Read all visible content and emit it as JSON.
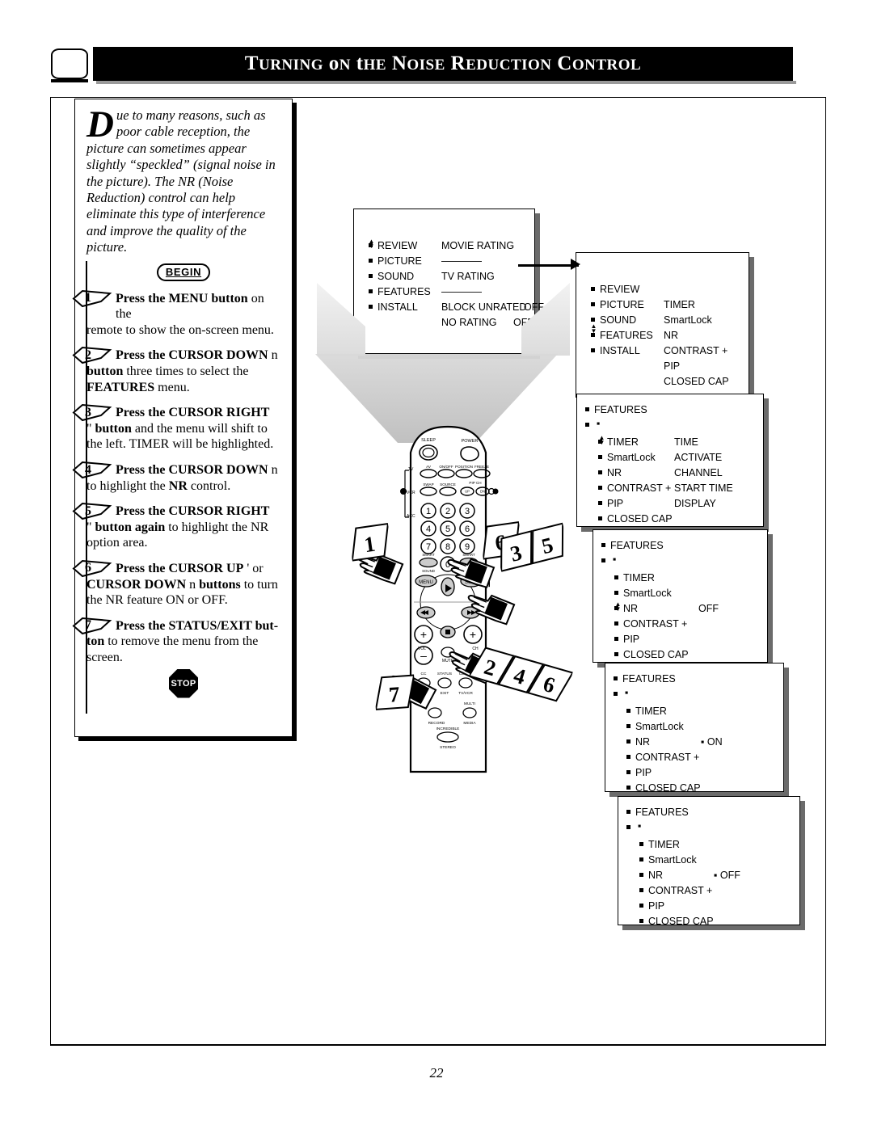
{
  "header": {
    "title": "Turning on the Noise Reduction Control",
    "tv_icon": "tv-screen-icon"
  },
  "intro": {
    "dropcap": "D",
    "text": "ue to many reasons, such as poor cable reception, the picture can sometimes appear slightly “speckled” (signal noise in the picture). The NR (Noise Reduction) control can help eliminate this type of interference and improve the quality of the picture."
  },
  "begin_label": "BEGIN",
  "stop_label": "STOP",
  "steps": [
    {
      "number": "1",
      "line1": "Press the MENU button",
      "line1_tail": " on the",
      "rest": "remote to show the on-screen menu."
    },
    {
      "number": "2",
      "line1": "Press the CURSOR DOWN",
      "line1_tail": " n",
      "rest": "button three times to select the FEATURES menu."
    },
    {
      "number": "3",
      "line1": "Press the CURSOR RIGHT",
      "line1_tail": "",
      "rest": "\" button and the menu will shift to the left. TIMER will be highlighted."
    },
    {
      "number": "4",
      "line1": "Press the CURSOR DOWN",
      "line1_tail": " n",
      "rest": "to highlight the NR control."
    },
    {
      "number": "5",
      "line1": "Press the CURSOR RIGHT",
      "line1_tail": "",
      "rest": "\" button again to highlight the NR option area."
    },
    {
      "number": "6",
      "line1": "Press the CURSOR UP",
      "line1_tail": " '   or",
      "rest": "CURSOR DOWN n buttons to turn the NR feature ON or OFF."
    },
    {
      "number": "7",
      "line1": "Press the STATUS/EXIT but-",
      "line1_tail": "",
      "rest": "ton to remove the menu from the screen."
    }
  ],
  "screens": [
    {
      "id": "screen-main-menu",
      "left_items": [
        "REVIEW",
        "PICTURE",
        "SOUND",
        "FEATURES",
        "INSTALL"
      ],
      "right_items": [
        "MOVIE RATING",
        "————",
        "TV RATING",
        "————",
        "BLOCK UNRATED",
        "NO RATING"
      ],
      "values": [
        "",
        "",
        "",
        "",
        "OFF",
        "OFF"
      ],
      "cursor_row": 0
    },
    {
      "id": "screen-features-selected",
      "left_items": [
        "REVIEW",
        "PICTURE",
        "SOUND",
        "FEATURES",
        "INSTALL"
      ],
      "right_items": [
        "",
        "TIMER",
        "SmartLock",
        "NR",
        "CONTRAST +",
        "PIP",
        "CLOSED CAP"
      ],
      "cursor_row": 3
    },
    {
      "id": "screen-features-timer",
      "title": "FEATURES",
      "left_items": [
        "TIMER",
        "SmartLock",
        "NR",
        "CONTRAST +",
        "PIP",
        "CLOSED CAP"
      ],
      "right_items": [
        "TIME",
        "ACTIVATE",
        "CHANNEL",
        "START TIME",
        "DISPLAY"
      ],
      "cursor_row": 0
    },
    {
      "id": "screen-features-nr-off",
      "title": "FEATURES",
      "left_items": [
        "TIMER",
        "SmartLock",
        "NR",
        "CONTRAST +",
        "PIP",
        "CLOSED CAP"
      ],
      "nr_value": "OFF",
      "cursor_row": 2
    },
    {
      "id": "screen-features-nr-on",
      "title": "FEATURES",
      "left_items": [
        "TIMER",
        "SmartLock",
        "NR",
        "CONTRAST +",
        "PIP",
        "CLOSED CAP"
      ],
      "nr_value": "ON",
      "cursor_row": 2
    },
    {
      "id": "screen-features-nr-off-final",
      "title": "FEATURES",
      "left_items": [
        "TIMER",
        "SmartLock",
        "NR",
        "CONTRAST +",
        "PIP",
        "CLOSED CAP"
      ],
      "nr_value": "OFF",
      "cursor_row": 2
    }
  ],
  "remote": {
    "labels": {
      "sleep": "SLEEP",
      "power": "POWER",
      "tv": "TV",
      "vcr": "VCR",
      "acc": "ACC",
      "av": "AV",
      "onoff": "ON/OFF",
      "position": "POSITION",
      "freeze": "FREEZE",
      "swap": "SWAP",
      "source": "SOURCE",
      "pipch": "PIP CH",
      "up": "UP",
      "dn": "DN",
      "smart_sound": "SMART SOUND",
      "smart_picture": "SMART PICTURE",
      "menu": "MENU",
      "surf": "SURF",
      "vol": "VOL",
      "ch": "CH",
      "mute": "MUTE",
      "cc": "CC",
      "status_exit": "STATUS EXIT",
      "clock": "CLOCK",
      "tvvcr": "TV/VCR",
      "record": "RECORD",
      "multi_media": "MULTI MEDIA",
      "incredible_stereo": "INCREDIBLE STEREO"
    },
    "keypad": [
      "1",
      "2",
      "3",
      "4",
      "5",
      "6",
      "7",
      "8",
      "9",
      "0"
    ]
  },
  "callouts": [
    {
      "id": "callout-1",
      "labels": [
        "1"
      ]
    },
    {
      "id": "callout-6",
      "labels": [
        "6"
      ]
    },
    {
      "id": "callout-3-5",
      "labels": [
        "3",
        "5"
      ]
    },
    {
      "id": "callout-2-4-6",
      "labels": [
        "2",
        "4",
        "6"
      ]
    },
    {
      "id": "callout-7",
      "labels": [
        "7"
      ]
    }
  ],
  "page_number": "22"
}
